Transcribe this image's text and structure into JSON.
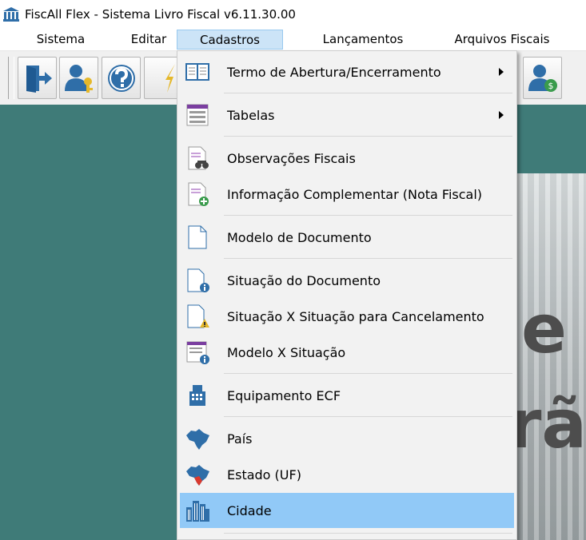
{
  "window": {
    "title": "FiscAll Flex - Sistema Livro Fiscal v6.11.30.00"
  },
  "menubar": {
    "items": [
      {
        "label": "Sistema"
      },
      {
        "label": "Editar"
      },
      {
        "label": "Cadastros"
      },
      {
        "label": "Lançamentos"
      },
      {
        "label": "Arquivos Fiscais"
      }
    ]
  },
  "toolbar": {
    "buttons": [
      {
        "icon": "exit-door-icon"
      },
      {
        "icon": "user-key-icon"
      },
      {
        "icon": "help-icon"
      },
      {
        "icon": "lightning-icon"
      },
      {
        "icon": "user-money-icon"
      }
    ]
  },
  "dropdown": {
    "items": [
      {
        "label": "Termo de Abertura/Encerramento",
        "icon": "book-icon",
        "submenu": true
      },
      {
        "label": "Tabelas",
        "icon": "table-icon",
        "submenu": true
      },
      {
        "label": "Observações Fiscais",
        "icon": "document-binoculars-icon"
      },
      {
        "label": "Informação Complementar (Nota Fiscal)",
        "icon": "document-add-icon"
      },
      {
        "label": "Modelo de Documento",
        "icon": "document-icon"
      },
      {
        "label": "Situação do Documento",
        "icon": "document-info-icon"
      },
      {
        "label": "Situação X Situação para Cancelamento",
        "icon": "document-warning-icon"
      },
      {
        "label": "Modelo X Situação",
        "icon": "form-info-icon"
      },
      {
        "label": "Equipamento ECF",
        "icon": "cash-register-icon"
      },
      {
        "label": "País",
        "icon": "country-map-icon"
      },
      {
        "label": "Estado (UF)",
        "icon": "state-map-icon"
      },
      {
        "label": "Cidade",
        "icon": "city-buildings-icon",
        "highlighted": true
      }
    ]
  },
  "banner": {
    "text_line1": "e",
    "text_line2": "rão"
  },
  "colors": {
    "workspace": "#3f7b78",
    "menu_active": "#cce4f7",
    "item_highlight": "#91c9f7",
    "icon_blue": "#2f6ea8"
  }
}
